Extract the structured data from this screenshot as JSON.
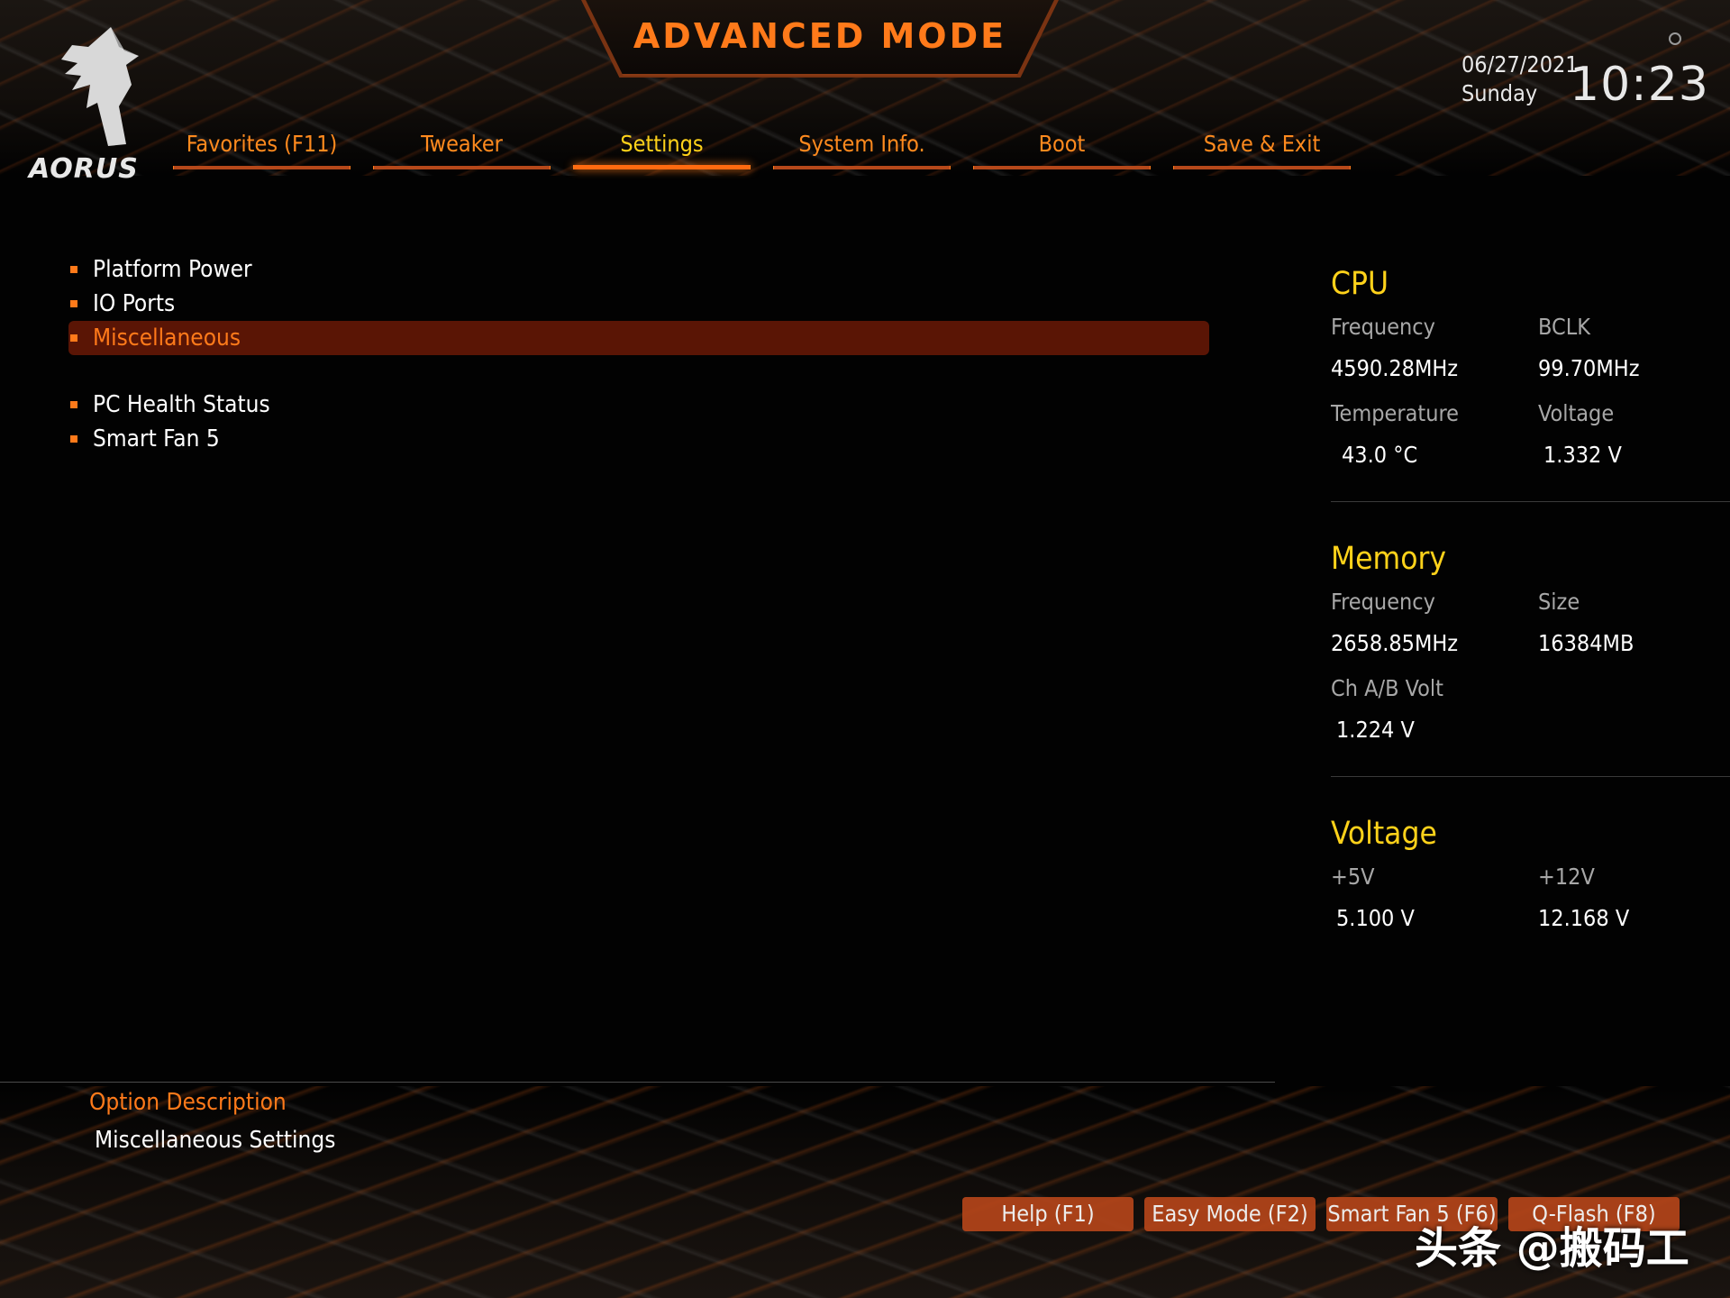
{
  "header": {
    "title": "ADVANCED MODE",
    "logo_text": "AORUS",
    "date": "06/27/2021",
    "day": "Sunday",
    "time": "10:23"
  },
  "tabs": [
    {
      "label": "Favorites (F11)",
      "active": false
    },
    {
      "label": "Tweaker",
      "active": false
    },
    {
      "label": "Settings",
      "active": true
    },
    {
      "label": "System Info.",
      "active": false
    },
    {
      "label": "Boot",
      "active": false
    },
    {
      "label": "Save & Exit",
      "active": false
    }
  ],
  "menu": [
    {
      "label": "Platform Power",
      "selected": false
    },
    {
      "label": "IO Ports",
      "selected": false
    },
    {
      "label": "Miscellaneous",
      "selected": true
    },
    {
      "label": "PC Health Status",
      "selected": false
    },
    {
      "label": "Smart Fan 5",
      "selected": false
    }
  ],
  "info": {
    "cpu": {
      "title": "CPU",
      "frequency_label": "Frequency",
      "frequency": "4590.28MHz",
      "bclk_label": "BCLK",
      "bclk": "99.70MHz",
      "temperature_label": "Temperature",
      "temperature": "43.0 °C",
      "voltage_label": "Voltage",
      "voltage": "1.332 V"
    },
    "memory": {
      "title": "Memory",
      "frequency_label": "Frequency",
      "frequency": "2658.85MHz",
      "size_label": "Size",
      "size": "16384MB",
      "chab_label": "Ch A/B Volt",
      "chab": "1.224 V"
    },
    "voltage": {
      "title": "Voltage",
      "v5_label": "+5V",
      "v5": "5.100 V",
      "v12_label": "+12V",
      "v12": "12.168 V"
    }
  },
  "description": {
    "title": "Option Description",
    "text": "Miscellaneous Settings"
  },
  "buttons": [
    {
      "label": "Help (F1)"
    },
    {
      "label": "Easy Mode (F2)"
    },
    {
      "label": "Smart Fan 5 (F6)"
    },
    {
      "label": "Q-Flash (F8)"
    }
  ],
  "watermark": "头条 @搬码工",
  "colors": {
    "accent": "#ff7a1a",
    "highlight": "#ffd21a",
    "selected_bg": "#5a1505",
    "button_bg": "#b4451a"
  }
}
